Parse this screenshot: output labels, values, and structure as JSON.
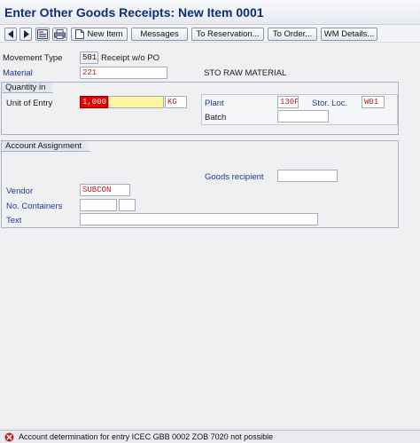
{
  "window": {
    "title": "Enter Other Goods Receipts: New Item 0001"
  },
  "toolbar": {
    "new_item": "New Item",
    "messages": "Messages",
    "to_reservation": "To Reservation...",
    "to_order": "To Order...",
    "wm_details": "WM Details..."
  },
  "header": {
    "movement_type_label": "Movement Type",
    "movement_type_value": "501",
    "movement_type_desc": "Receipt w/o PO",
    "material_label": "Material",
    "material_value": "221",
    "material_desc": "STO RAW MATERIAL"
  },
  "quantity_group": {
    "title": "Quantity in",
    "unit_of_entry_label": "Unit of Entry",
    "quantity_value": "1,000",
    "unit_value": "KG",
    "plant_label": "Plant",
    "plant_value": "130F",
    "stor_loc_label": "Stor. Loc.",
    "stor_loc_value": "W01",
    "batch_label": "Batch",
    "batch_value": ""
  },
  "account_group": {
    "title": "Account Assignment",
    "goods_recipient_label": "Goods recipient",
    "goods_recipient_value": "",
    "vendor_label": "Vendor",
    "vendor_value": "SUBCON",
    "no_containers_label": "No. Containers",
    "no_containers_value": "",
    "no_containers_unit": "",
    "text_label": "Text",
    "text_value": ""
  },
  "status": {
    "message": "Account determination for entry ICEC GBB 0002 ZOB 7020 not possible",
    "type": "error",
    "error_color": "#cc1a1a"
  },
  "icons": [
    "prev-item-icon",
    "next-item-icon",
    "overview-icon",
    "print-icon",
    "new-item-icon"
  ]
}
